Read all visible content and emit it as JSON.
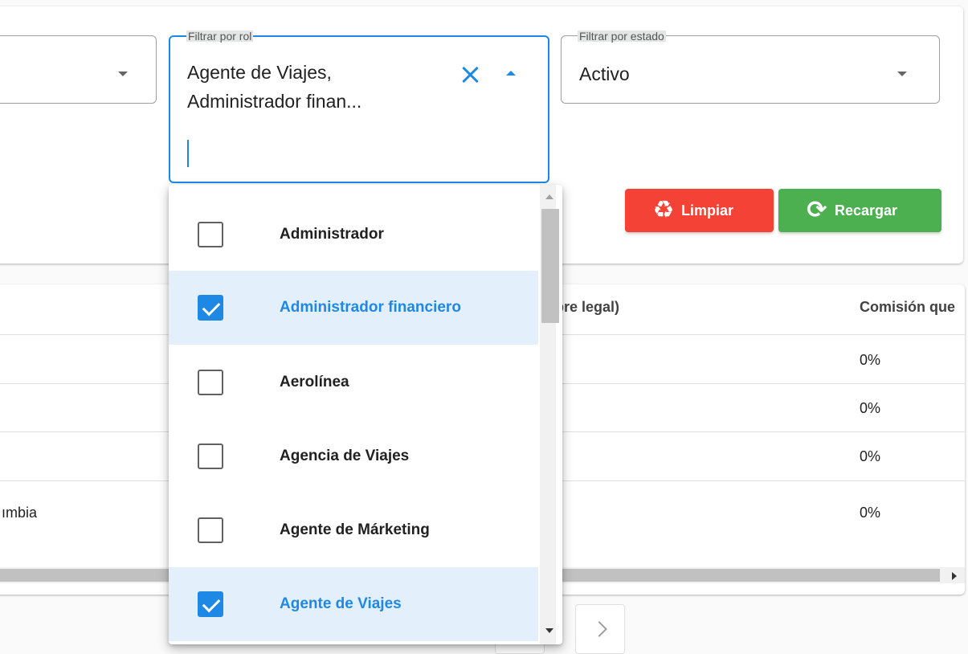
{
  "filters": {
    "role": {
      "legend": "Filtrar por rol",
      "selected_lines": [
        "Agente de Viajes,",
        "Administrador finan..."
      ]
    },
    "state": {
      "legend": "Filtrar por estado",
      "value": "Activo"
    }
  },
  "buttons": {
    "clear_label": "Limpiar",
    "reload_label": "Recargar"
  },
  "table": {
    "headers": [
      "nbre legal)",
      "Comisión que"
    ],
    "rows": [
      {
        "left": "",
        "commission": "0%"
      },
      {
        "left": "",
        "commission": "0%"
      },
      {
        "left": "",
        "commission": "0%"
      },
      {
        "left": "ımbia",
        "commission": "0%"
      }
    ]
  },
  "menu": {
    "options": [
      {
        "label": "Administrador",
        "checked": false
      },
      {
        "label": "Administrador financiero",
        "checked": true
      },
      {
        "label": "Aerolínea",
        "checked": false
      },
      {
        "label": "Agencia de Viajes",
        "checked": false
      },
      {
        "label": "Agente de Márketing",
        "checked": false
      },
      {
        "label": "Agente de Viajes",
        "checked": true
      }
    ]
  },
  "pagination": {
    "next_icon": "chevron-right-icon"
  },
  "colors": {
    "primary": "#1e88e5",
    "danger": "#f44336",
    "success": "#4caf50",
    "selected_bg": "#e3f0fb"
  },
  "icons": {
    "clear": "recycle-icon",
    "reload": "refresh-icon",
    "dropdown_open": "caret-up-icon",
    "dropdown_closed": "caret-down-icon",
    "clear_selection": "close-icon"
  }
}
